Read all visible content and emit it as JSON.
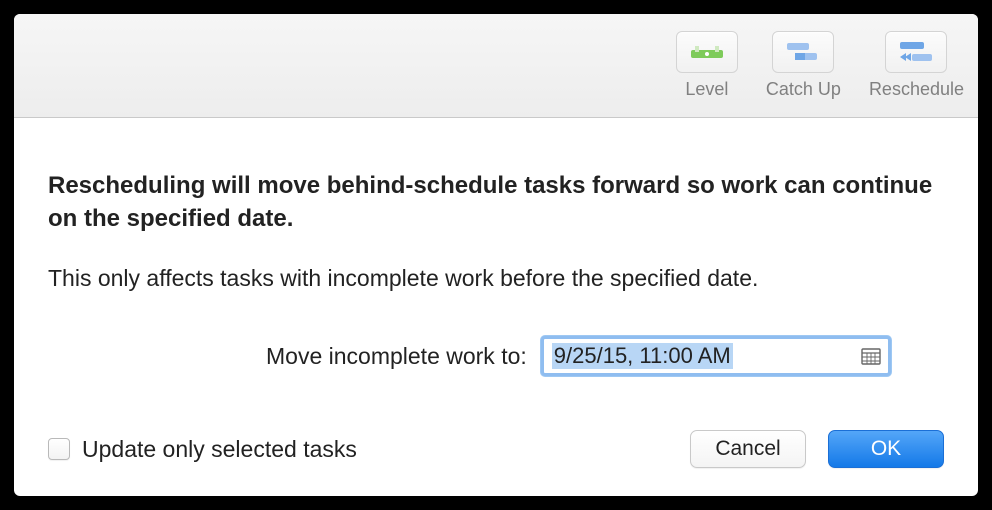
{
  "toolbar": {
    "level_label": "Level",
    "catchup_label": "Catch Up",
    "reschedule_label": "Reschedule"
  },
  "dialog": {
    "heading": "Rescheduling will move behind-schedule tasks forward so work can continue on the specified date.",
    "subtext": "This only affects tasks with incomplete work before the specified date.",
    "date_label": "Move incomplete work to:",
    "date_value": "9/25/15, 11:00 AM",
    "checkbox_label": "Update only selected tasks",
    "cancel_label": "Cancel",
    "ok_label": "OK"
  },
  "icons": {
    "level_color": "#7ecb5a",
    "tasks_color": "#6fa6e6"
  }
}
